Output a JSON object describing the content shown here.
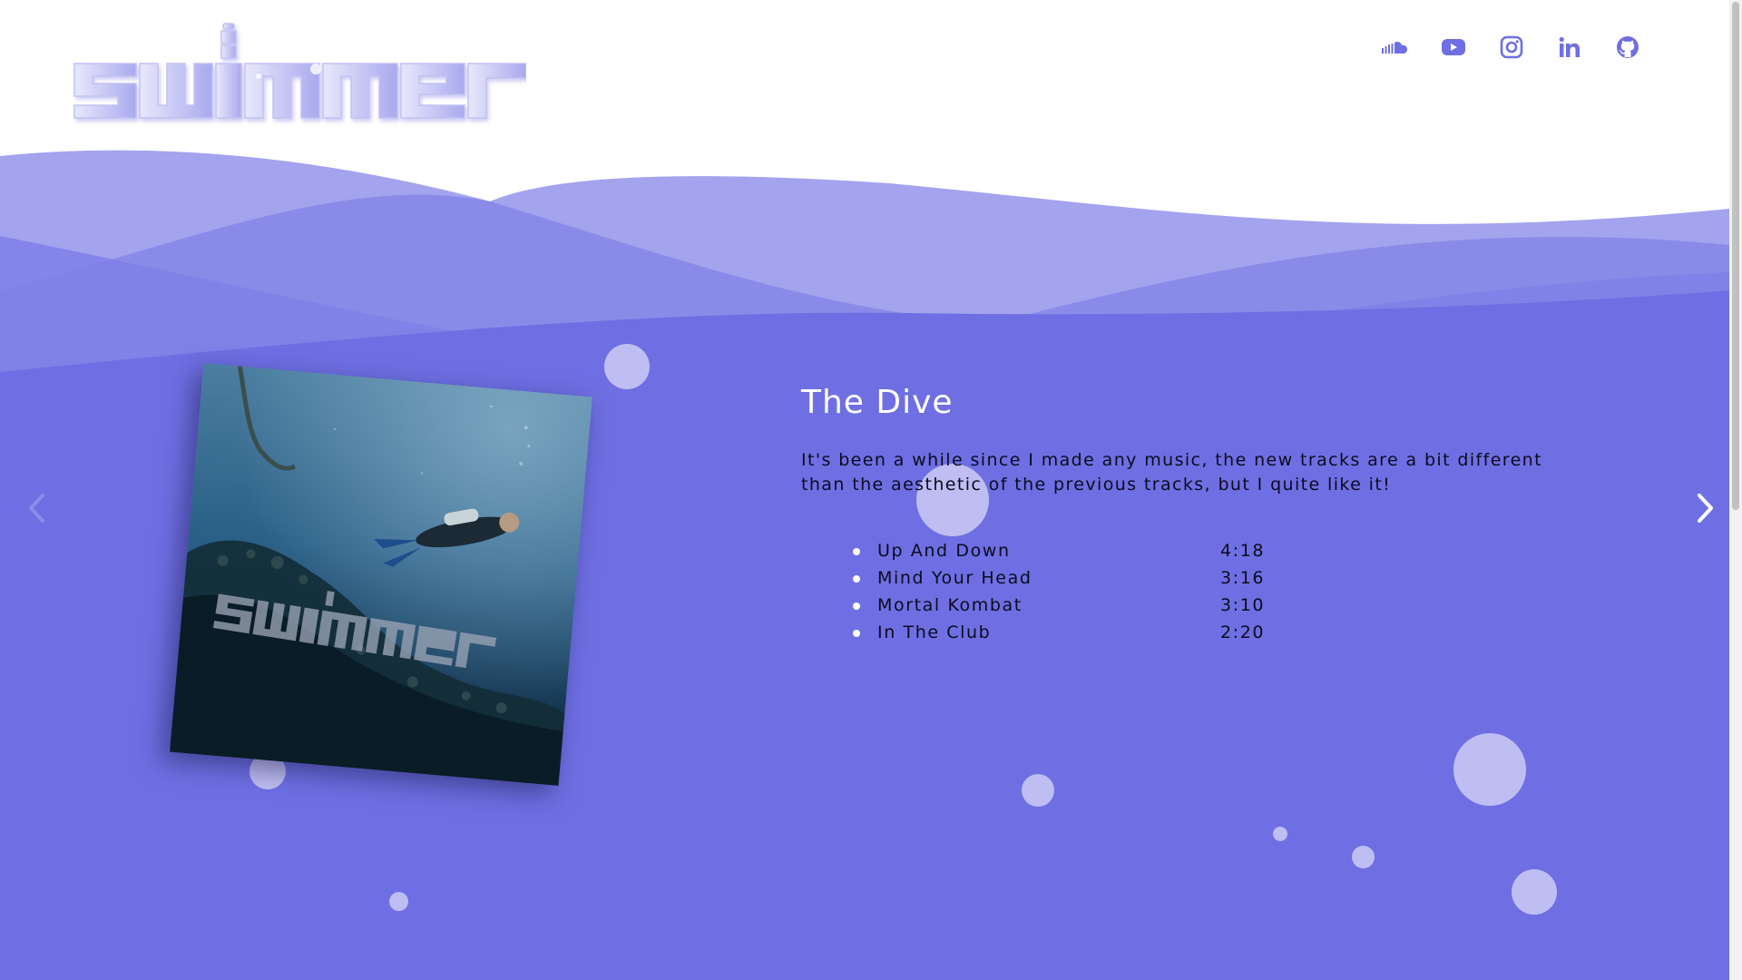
{
  "header": {
    "logo_text": "swimmer",
    "social": [
      {
        "name": "SoundCloud",
        "icon": "soundcloud-icon"
      },
      {
        "name": "YouTube",
        "icon": "youtube-icon"
      },
      {
        "name": "Instagram",
        "icon": "instagram-icon"
      },
      {
        "name": "LinkedIn",
        "icon": "linkedin-icon"
      },
      {
        "name": "GitHub",
        "icon": "github-icon"
      }
    ]
  },
  "release": {
    "title": "The Dive",
    "description": "It's been a while since I made any music, the new tracks are a bit different than the aesthetic of the previous tracks, but I quite like it!",
    "cover_text": "swimmer",
    "tracks": [
      {
        "name": "Up And Down",
        "length": "4:18"
      },
      {
        "name": "Mind Your Head",
        "length": "3:16"
      },
      {
        "name": "Mortal Kombat",
        "length": "3:10"
      },
      {
        "name": "In The Club",
        "length": "2:20"
      }
    ]
  },
  "carousel": {
    "prev_icon": "chevron-left-icon",
    "next_icon": "chevron-right-icon"
  },
  "colors": {
    "accent": "#6f6fe3",
    "wave_light": "#a3a3ee",
    "logo": "#dcdcf7",
    "bubble": "#dcdcf8"
  }
}
